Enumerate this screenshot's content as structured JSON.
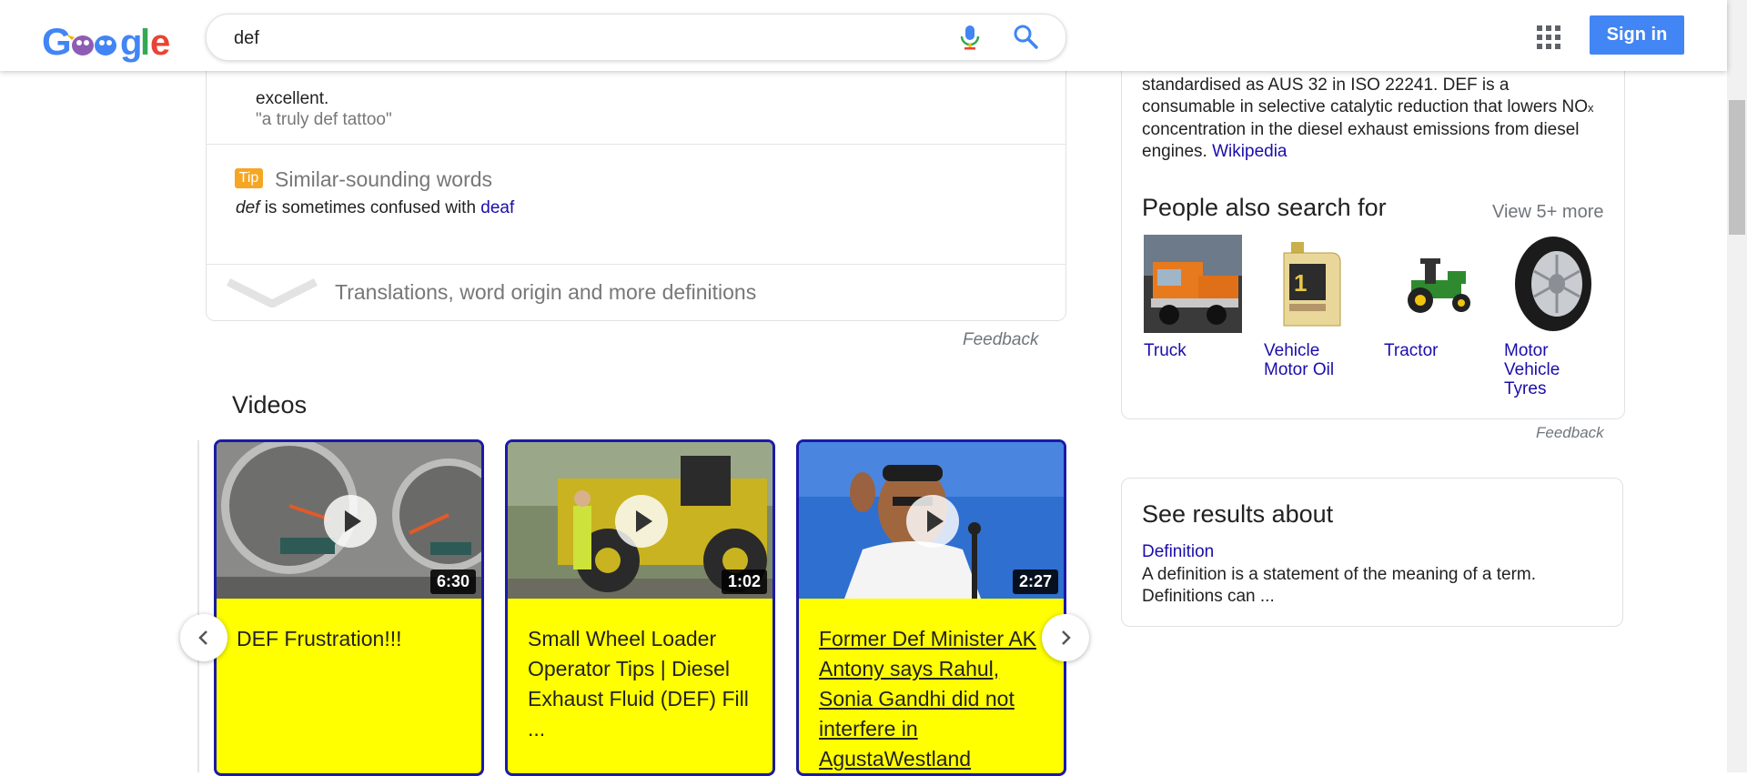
{
  "header": {
    "logo_alt": "Google",
    "search_value": "def",
    "signin_label": "Sign in"
  },
  "dictionary": {
    "definition_tail": "excellent.",
    "example": "\"a truly def tattoo\"",
    "tip_badge": "Tip",
    "similar_title": "Similar-sounding words",
    "similar_word": "def",
    "similar_middle": " is sometimes confused with ",
    "similar_link": "deaf",
    "more_label": "Translations, word origin and more definitions",
    "feedback": "Feedback"
  },
  "videos": {
    "title": "Videos",
    "items": [
      {
        "title": "DEF Frustration!!!",
        "duration": "6:30"
      },
      {
        "title": "Small Wheel Loader Operator Tips | Diesel Exhaust Fluid (DEF) Fill ...",
        "duration": "1:02"
      },
      {
        "title": "Former Def Minister AK Antony says Rahul, Sonia Gandhi did not interfere in AgustaWestland",
        "duration": "2:27"
      }
    ]
  },
  "knowledge_panel": {
    "desc_1": "standardised as AUS 32 in ISO 22241. DEF is a consumable in selective catalytic reduction that lowers NO",
    "desc_sub": "x",
    "desc_2": " concentration in the diesel exhaust emissions from diesel engines. ",
    "desc_link": "Wikipedia",
    "pasf_title": "People also search for",
    "view_more": "View 5+ more",
    "entities": [
      {
        "name": "Truck"
      },
      {
        "name": "Vehicle Motor Oil"
      },
      {
        "name": "Tractor"
      },
      {
        "name": "Motor Vehicle Tyres"
      }
    ],
    "feedback": "Feedback"
  },
  "see_results": {
    "title": "See results about",
    "link": "Definition",
    "desc": "A definition is a statement of the meaning of a term. Definitions can ..."
  },
  "colors": {
    "link": "#1a0dab",
    "signin_bg": "#4285f4",
    "video_card_bg": "#ffff00",
    "video_card_border": "#1a1aa6",
    "tip_badge": "#f6a623"
  }
}
